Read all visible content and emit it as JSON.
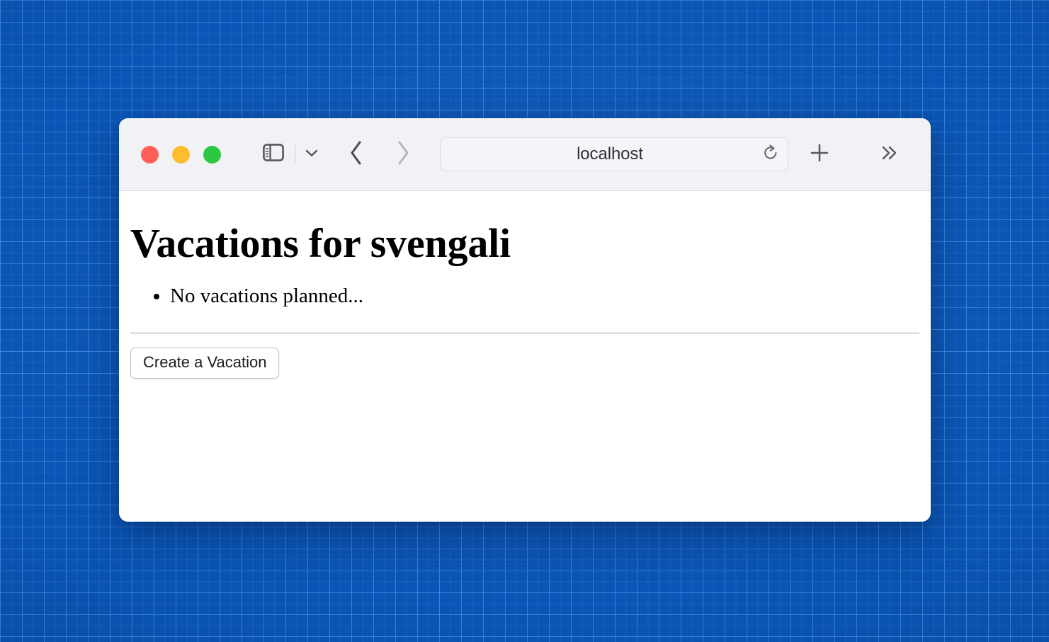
{
  "browser": {
    "window_controls": [
      {
        "name": "close",
        "color": "#ff5f57"
      },
      {
        "name": "minimize",
        "color": "#febc2e"
      },
      {
        "name": "maximize",
        "color": "#2bc840"
      }
    ],
    "sidebar_toggle_icon": "sidebar-icon",
    "sidebar_dropdown_icon": "chevron-down-icon",
    "back_icon": "chevron-left-icon",
    "forward_icon": "chevron-right-icon",
    "back_enabled": "true",
    "forward_enabled": "false",
    "address": {
      "value": "localhost",
      "placeholder": "Search or enter website name",
      "reload_icon": "reload-icon"
    },
    "new_tab_icon": "plus-icon",
    "overflow_icon": "chevrons-right-icon"
  },
  "page": {
    "title": "Vacations for svengali",
    "list": [
      "No vacations planned..."
    ],
    "create_button_label": "Create a Vacation"
  },
  "colors": {
    "desktop": "#0a55b5",
    "grid_line": "#56a3f3",
    "toolbar_bg": "#f1f2f6",
    "content_bg": "#ffffff",
    "icon": "#57575c",
    "icon_disabled": "#b5b6bb",
    "divider": "#9a9a9a"
  }
}
